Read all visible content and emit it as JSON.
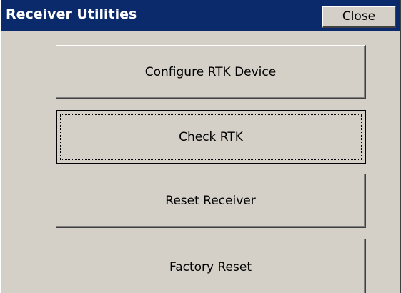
{
  "window": {
    "title": "Receiver Utilities",
    "close_mnemonic": "C",
    "close_rest": "lose"
  },
  "buttons": [
    {
      "label": "Configure RTK Device"
    },
    {
      "label": "Check RTK"
    },
    {
      "label": "Reset Receiver"
    },
    {
      "label": "Factory Reset"
    }
  ],
  "colors": {
    "titlebar": "#0a2a6b",
    "face": "#d4d0c8"
  }
}
